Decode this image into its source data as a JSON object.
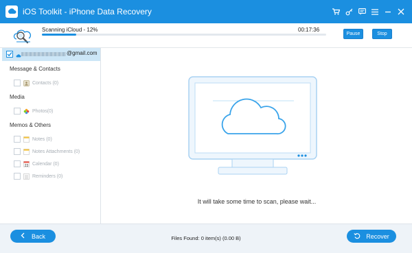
{
  "window": {
    "title": "iOS Toolkit - iPhone Data Recovery",
    "icons": [
      "cart-icon",
      "key-icon",
      "feedback-icon",
      "menu-icon",
      "minimize-icon",
      "close-icon"
    ]
  },
  "scan": {
    "label": "Scanning iCloud - 12%",
    "progress_percent": 12,
    "elapsed": "00:17:36",
    "pause_label": "Pause",
    "stop_label": "Stop"
  },
  "sidebar": {
    "account": "@gmail.com",
    "groups": [
      {
        "label": "Message & Contacts",
        "items": [
          {
            "label": "Contacts (0)",
            "icon": "contacts-icon"
          }
        ]
      },
      {
        "label": "Media",
        "items": [
          {
            "label": "Photos(0)",
            "icon": "photos-icon"
          }
        ]
      },
      {
        "label": "Memos & Others",
        "items": [
          {
            "label": "Notes (0)",
            "icon": "notes-icon"
          },
          {
            "label": "Notes Attachments (0)",
            "icon": "notes-attachments-icon"
          },
          {
            "label": "Calendar (0)",
            "icon": "calendar-icon"
          },
          {
            "label": "Reminders (0)",
            "icon": "reminders-icon"
          }
        ]
      }
    ]
  },
  "main": {
    "wait_message": "It will take some time to scan, please wait...",
    "calendar_day": "23"
  },
  "footer": {
    "back_label": "Back",
    "files_found": "Files Found: 0 item(s) (0.00 B)",
    "recover_label": "Recover"
  },
  "colors": {
    "accent": "#1b8fe0",
    "selected_row": "#cce6f7",
    "footer_bg": "#eef3f8"
  }
}
